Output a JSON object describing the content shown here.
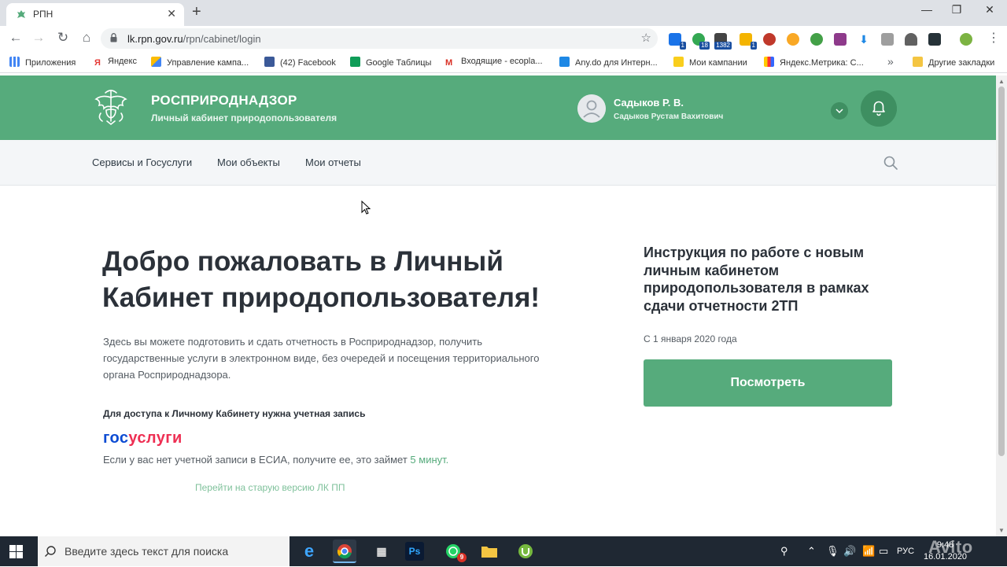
{
  "browser": {
    "tab_title": "РПН",
    "url_host": "lk.rpn.gov.ru",
    "url_path": "/rpn/cabinet/login",
    "extension_badges": [
      "1",
      "18",
      "1382",
      "1"
    ],
    "bookmarks": [
      "Приложения",
      "Яндекс",
      "Управление кампа...",
      "(42) Facebook",
      "Google Таблицы",
      "Входящие - ecopla...",
      "Any.do для Интерн...",
      "Мои кампании",
      "Яндекс.Метрика: С...",
      "Другие закладки"
    ],
    "bookmark_more": "»"
  },
  "header": {
    "org_name": "РОСПРИРОДНАДЗОР",
    "org_subtitle": "Личный кабинет природопользователя",
    "user_short": "Садыков Р. В.",
    "user_full": "Садыков Рустам Вахитович"
  },
  "nav": {
    "items": [
      "Сервисы и Госуслуги",
      "Мои объекты",
      "Мои отчеты"
    ]
  },
  "main": {
    "welcome_title": "Добро пожаловать в Личный Кабинет природопользователя!",
    "intro": "Здесь вы можете подготовить и сдать отчетность в Росприроднадзор, получить государственные услуги в электронном виде, без очередей и посещения территориального органа Росприроднадзора.",
    "access_note": "Для доступа к Личному Кабинету нужна учетная запись",
    "gosuslugi_part1": "гос",
    "gosuslugi_part2": "услуги",
    "esia_text": "Если у вас нет учетной записи в ЕСИА, получите ее, это займет ",
    "esia_link": "5 минут.",
    "old_version_link": "Перейти на старую версию ЛК ПП"
  },
  "sidebar": {
    "instruction_title": "Инструкция по работе с новым личным кабинетом природопользователя в рамках сдачи отчетности 2ТП",
    "instruction_date": "С 1 января 2020 года",
    "view_button": "Посмотреть"
  },
  "taskbar": {
    "search_placeholder": "Введите здесь текст для поиска",
    "whatsapp_badge": "9",
    "lang": "РУС",
    "time": "9:48",
    "date": "16.01.2020"
  },
  "watermark": "Avito",
  "colors": {
    "brand_green": "#56ab7c",
    "dark_green": "#3e8f61",
    "gos_blue": "#0d4cd3",
    "gos_red": "#ee2f53"
  }
}
